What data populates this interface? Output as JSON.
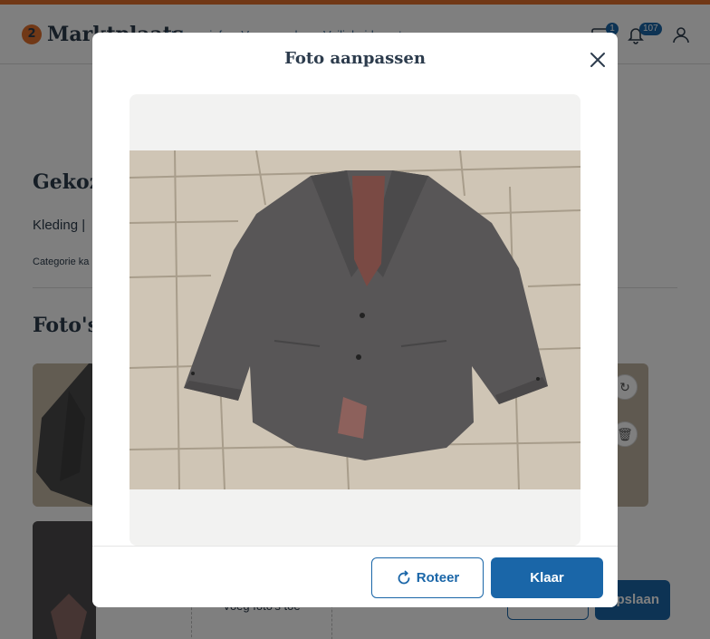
{
  "header": {
    "logo_glyph": "2",
    "logo_text": "Marktplaats",
    "nav": [
      "Help en info",
      "Voorwaarden",
      "Veiligheidscentrum"
    ],
    "messages_badge": "1",
    "notifications_badge": "107"
  },
  "page": {
    "chosen_category_heading": "Gekoze",
    "category_path": "Kleding |",
    "category_small": "Categorie ka",
    "photos_heading": "Foto's",
    "add_photo_label": "Voeg foto's toe",
    "save_button_label": "Opslaan"
  },
  "modal": {
    "title": "Foto aanpassen",
    "rotate_label": "Roteer",
    "done_label": "Klaar"
  },
  "colors": {
    "brand_orange": "#e3702d",
    "primary_blue": "#1a66a8",
    "text_dark": "#2d3c4d",
    "stage_bg": "#f2f2f1"
  },
  "icons": {
    "close": "close-icon",
    "rotate": "rotate-icon",
    "messages": "chat-bubble-icon",
    "notifications": "bell-icon",
    "profile": "user-icon"
  }
}
